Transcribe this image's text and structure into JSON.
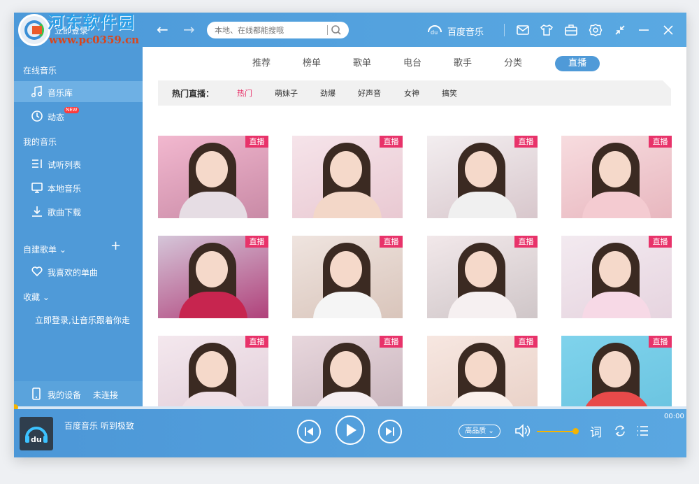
{
  "watermark": {
    "title": "河东软件园",
    "url": "www.pc0359.cn"
  },
  "header": {
    "login": "立即登录",
    "search_placeholder": "本地、在线都能搜哦",
    "brand": "百度音乐"
  },
  "sidebar": {
    "online_music": "在线音乐",
    "music_library": "音乐库",
    "dynamic": "动态",
    "new_badge": "NEW",
    "my_music": "我的音乐",
    "trial_list": "试听列表",
    "local_music": "本地音乐",
    "downloads": "歌曲下载",
    "custom_playlists": "自建歌单",
    "favorite_songs": "我喜欢的单曲",
    "favorites": "收藏",
    "login_prompt": "立即登录,让音乐跟着你走",
    "my_device": "我的设备",
    "device_status": "未连接"
  },
  "tabs": [
    "推荐",
    "榜单",
    "歌单",
    "电台",
    "歌手",
    "分类",
    "直播"
  ],
  "active_tab": "直播",
  "hot_live": {
    "title": "热门直播：",
    "tags": [
      "热门",
      "萌妹子",
      "劲爆",
      "好声音",
      "女神",
      "搞笑"
    ]
  },
  "live_label": "直播",
  "player": {
    "song": "百度音乐 听到极致",
    "quality": "高品质",
    "lyrics": "词",
    "time": "00:00",
    "progress": 0,
    "volume": 1.0
  },
  "colors": {
    "accent": "#4f9ad8",
    "live": "#e8336a",
    "hot_active": "#e8336a",
    "volume": "#f5b400"
  }
}
